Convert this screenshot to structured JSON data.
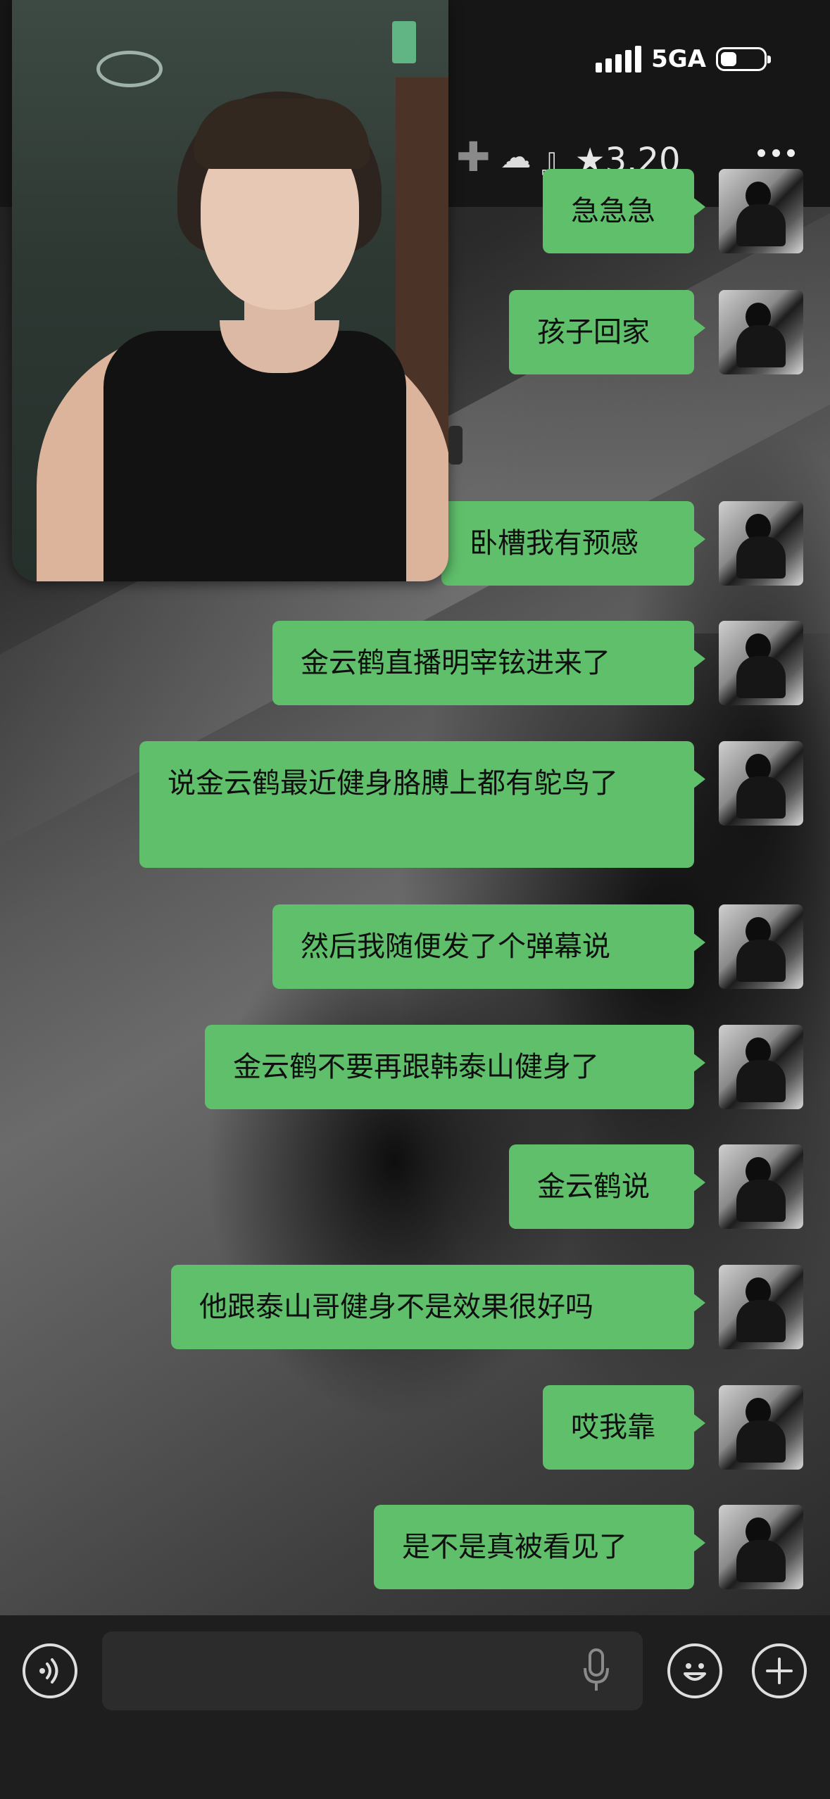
{
  "status_bar": {
    "network": "5GA",
    "battery_level": 0.3
  },
  "header": {
    "title_suffix": "』★3.20",
    "icons": [
      "add-icon",
      "cloud-icon"
    ],
    "more_icon": "more-dots-icon"
  },
  "video_call": {
    "type": "floating-video-window"
  },
  "messages": [
    {
      "text": "急急急",
      "side": "right"
    },
    {
      "text": "孩子回家",
      "side": "right"
    },
    {
      "text": "卧槽我有预感",
      "side": "right"
    },
    {
      "text": "金云鹤直播明宰铉进来了",
      "side": "right"
    },
    {
      "text": "说金云鹤最近健身胳膊上都有鸵鸟了",
      "side": "right"
    },
    {
      "text": "然后我随便发了个弹幕说",
      "side": "right"
    },
    {
      "text": "金云鹤不要再跟韩泰山健身了",
      "side": "right"
    },
    {
      "text": "金云鹤说",
      "side": "right"
    },
    {
      "text": "他跟泰山哥健身不是效果很好吗",
      "side": "right"
    },
    {
      "text": "哎我靠",
      "side": "right"
    },
    {
      "text": "是不是真被看见了",
      "side": "right"
    }
  ],
  "input_bar": {
    "placeholder": "",
    "left_icon": "voice-icon",
    "mic_icon": "microphone-icon",
    "emoji_icon": "emoji-icon",
    "add_icon": "plus-circle-icon"
  },
  "colors": {
    "bubble": "#5fbf6b",
    "header_bg": "#161616",
    "input_bg": "#1e1e1e"
  }
}
